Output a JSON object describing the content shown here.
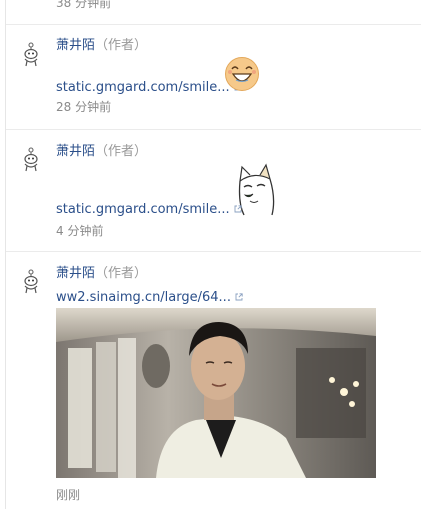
{
  "top_time": "38 分钟前",
  "comments": [
    {
      "author": "萧井陌",
      "role": "（作者）",
      "link": "static.gmgard.com/smile...",
      "time": "28 分钟前",
      "emoji": "laughing-face-sticker"
    },
    {
      "author": "萧井陌",
      "role": "（作者）",
      "link": "static.gmgard.com/smile...",
      "time": "4 分钟前",
      "emoji": "cat-sticker"
    },
    {
      "author": "萧井陌",
      "role": "（作者）",
      "link": "ww2.sinaimg.cn/large/64...",
      "time": "刚刚",
      "image": "man-in-white-suit-photo"
    }
  ],
  "colors": {
    "link": "#2b4f8a",
    "muted": "#8a8a8a",
    "divider": "#ebebeb"
  }
}
